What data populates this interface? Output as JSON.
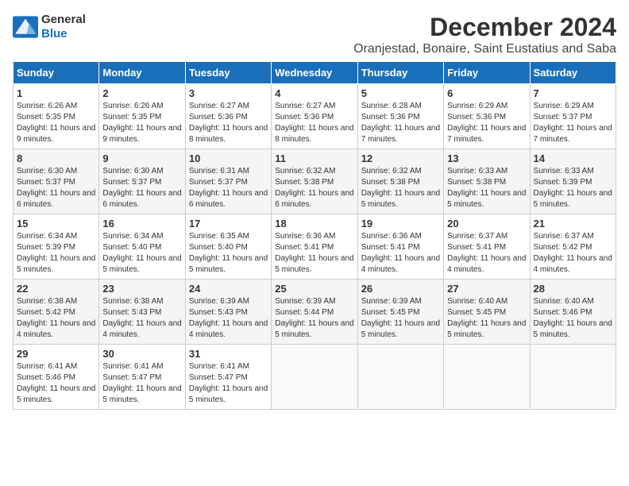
{
  "logo": {
    "line1": "General",
    "line2": "Blue"
  },
  "title": "December 2024",
  "subtitle": "Oranjestad, Bonaire, Saint Eustatius and Saba",
  "days_header": [
    "Sunday",
    "Monday",
    "Tuesday",
    "Wednesday",
    "Thursday",
    "Friday",
    "Saturday"
  ],
  "weeks": [
    [
      {
        "day": "1",
        "sunrise": "6:26 AM",
        "sunset": "5:35 PM",
        "daylight": "11 hours and 9 minutes."
      },
      {
        "day": "2",
        "sunrise": "6:26 AM",
        "sunset": "5:35 PM",
        "daylight": "11 hours and 9 minutes."
      },
      {
        "day": "3",
        "sunrise": "6:27 AM",
        "sunset": "5:36 PM",
        "daylight": "11 hours and 8 minutes."
      },
      {
        "day": "4",
        "sunrise": "6:27 AM",
        "sunset": "5:36 PM",
        "daylight": "11 hours and 8 minutes."
      },
      {
        "day": "5",
        "sunrise": "6:28 AM",
        "sunset": "5:36 PM",
        "daylight": "11 hours and 7 minutes."
      },
      {
        "day": "6",
        "sunrise": "6:29 AM",
        "sunset": "5:36 PM",
        "daylight": "11 hours and 7 minutes."
      },
      {
        "day": "7",
        "sunrise": "6:29 AM",
        "sunset": "5:37 PM",
        "daylight": "11 hours and 7 minutes."
      }
    ],
    [
      {
        "day": "8",
        "sunrise": "6:30 AM",
        "sunset": "5:37 PM",
        "daylight": "11 hours and 6 minutes."
      },
      {
        "day": "9",
        "sunrise": "6:30 AM",
        "sunset": "5:37 PM",
        "daylight": "11 hours and 6 minutes."
      },
      {
        "day": "10",
        "sunrise": "6:31 AM",
        "sunset": "5:37 PM",
        "daylight": "11 hours and 6 minutes."
      },
      {
        "day": "11",
        "sunrise": "6:32 AM",
        "sunset": "5:38 PM",
        "daylight": "11 hours and 6 minutes."
      },
      {
        "day": "12",
        "sunrise": "6:32 AM",
        "sunset": "5:38 PM",
        "daylight": "11 hours and 5 minutes."
      },
      {
        "day": "13",
        "sunrise": "6:33 AM",
        "sunset": "5:38 PM",
        "daylight": "11 hours and 5 minutes."
      },
      {
        "day": "14",
        "sunrise": "6:33 AM",
        "sunset": "5:39 PM",
        "daylight": "11 hours and 5 minutes."
      }
    ],
    [
      {
        "day": "15",
        "sunrise": "6:34 AM",
        "sunset": "5:39 PM",
        "daylight": "11 hours and 5 minutes."
      },
      {
        "day": "16",
        "sunrise": "6:34 AM",
        "sunset": "5:40 PM",
        "daylight": "11 hours and 5 minutes."
      },
      {
        "day": "17",
        "sunrise": "6:35 AM",
        "sunset": "5:40 PM",
        "daylight": "11 hours and 5 minutes."
      },
      {
        "day": "18",
        "sunrise": "6:36 AM",
        "sunset": "5:41 PM",
        "daylight": "11 hours and 5 minutes."
      },
      {
        "day": "19",
        "sunrise": "6:36 AM",
        "sunset": "5:41 PM",
        "daylight": "11 hours and 4 minutes."
      },
      {
        "day": "20",
        "sunrise": "6:37 AM",
        "sunset": "5:41 PM",
        "daylight": "11 hours and 4 minutes."
      },
      {
        "day": "21",
        "sunrise": "6:37 AM",
        "sunset": "5:42 PM",
        "daylight": "11 hours and 4 minutes."
      }
    ],
    [
      {
        "day": "22",
        "sunrise": "6:38 AM",
        "sunset": "5:42 PM",
        "daylight": "11 hours and 4 minutes."
      },
      {
        "day": "23",
        "sunrise": "6:38 AM",
        "sunset": "5:43 PM",
        "daylight": "11 hours and 4 minutes."
      },
      {
        "day": "24",
        "sunrise": "6:39 AM",
        "sunset": "5:43 PM",
        "daylight": "11 hours and 4 minutes."
      },
      {
        "day": "25",
        "sunrise": "6:39 AM",
        "sunset": "5:44 PM",
        "daylight": "11 hours and 5 minutes."
      },
      {
        "day": "26",
        "sunrise": "6:39 AM",
        "sunset": "5:45 PM",
        "daylight": "11 hours and 5 minutes."
      },
      {
        "day": "27",
        "sunrise": "6:40 AM",
        "sunset": "5:45 PM",
        "daylight": "11 hours and 5 minutes."
      },
      {
        "day": "28",
        "sunrise": "6:40 AM",
        "sunset": "5:46 PM",
        "daylight": "11 hours and 5 minutes."
      }
    ],
    [
      {
        "day": "29",
        "sunrise": "6:41 AM",
        "sunset": "5:46 PM",
        "daylight": "11 hours and 5 minutes."
      },
      {
        "day": "30",
        "sunrise": "6:41 AM",
        "sunset": "5:47 PM",
        "daylight": "11 hours and 5 minutes."
      },
      {
        "day": "31",
        "sunrise": "6:41 AM",
        "sunset": "5:47 PM",
        "daylight": "11 hours and 5 minutes."
      },
      null,
      null,
      null,
      null
    ]
  ]
}
